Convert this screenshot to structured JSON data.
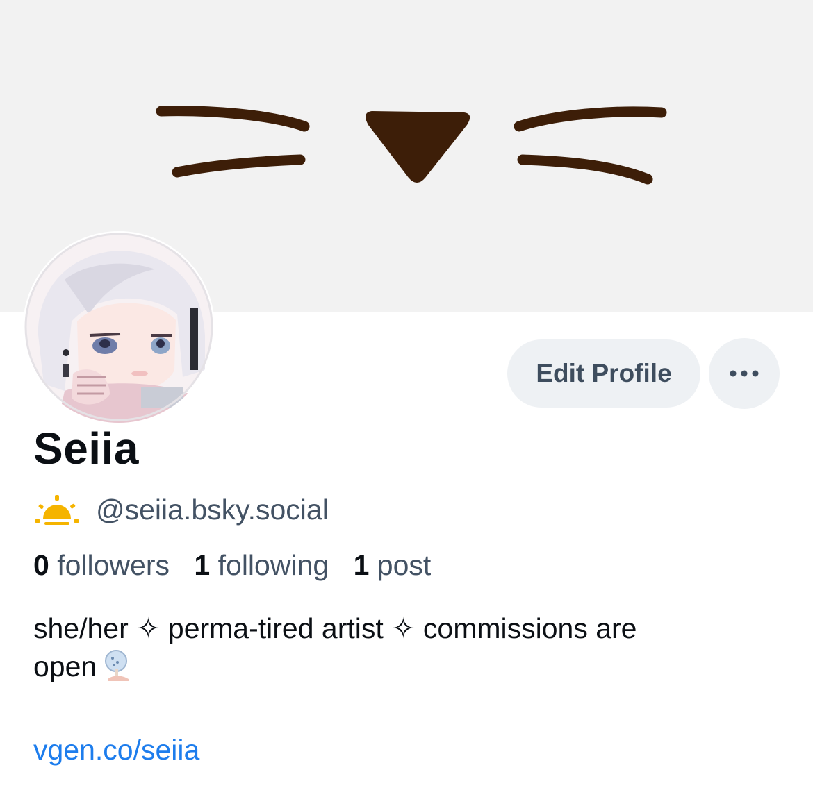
{
  "banner": {
    "background_color": "#f2f2f2",
    "art_color": "#3d1e08",
    "art_description": "cat-face-whiskers"
  },
  "profile": {
    "display_name": "Seiia",
    "handle_emoji": "sunrise-emoji",
    "handle": "@seiia.bsky.social",
    "stats": {
      "followers_count": "0",
      "followers_label": "followers",
      "following_count": "1",
      "following_label": "following",
      "posts_count": "1",
      "posts_label": "post"
    },
    "bio": {
      "line_1": "she/her ✧ perma-tired artist ✧ commissions are",
      "line_2": "open",
      "emoji": "paper-fan-emoji"
    },
    "link": "vgen.co/seiia"
  },
  "actions": {
    "edit_profile_label": "Edit Profile",
    "more_label": "···"
  },
  "colors": {
    "text_primary": "#0b0f14",
    "text_secondary": "#435264",
    "link": "#1d7ded",
    "button_bg": "#eef1f4",
    "button_text": "#3e4d5e"
  }
}
